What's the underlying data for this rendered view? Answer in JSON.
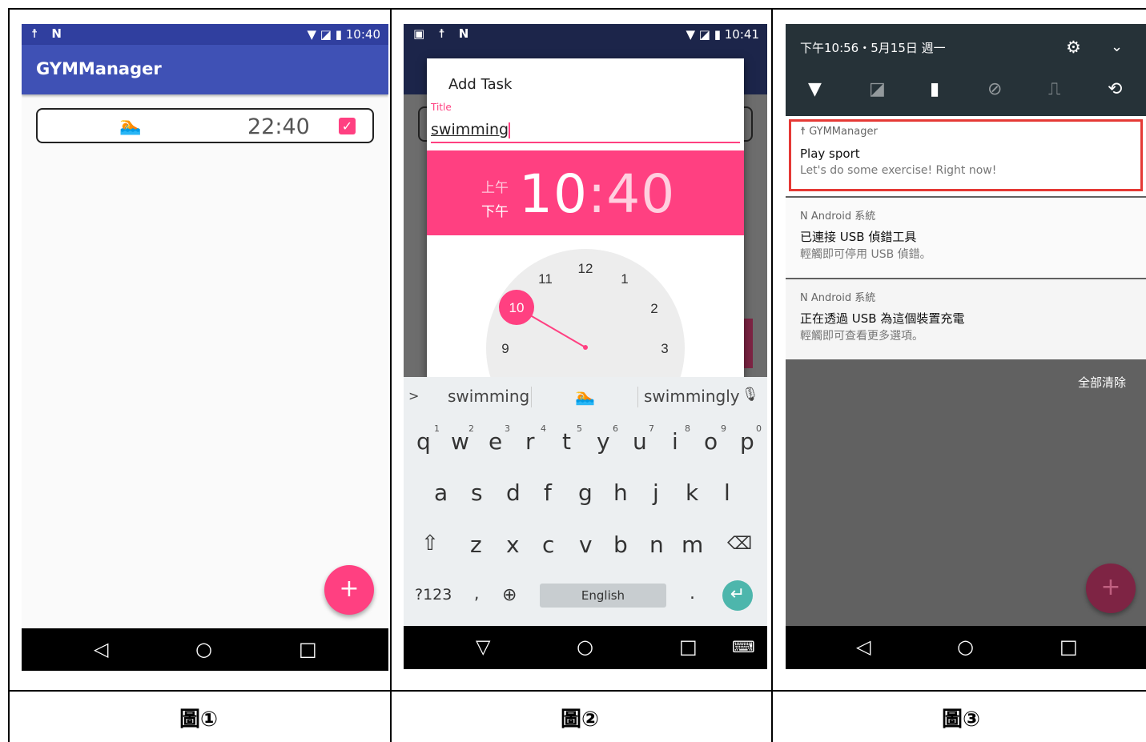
{
  "captions": [
    "圖①",
    "圖②",
    "圖③"
  ],
  "screen1": {
    "status": {
      "left_icons": "☨ N",
      "time": "10:40",
      "right_icons": "▼ ◪ ▮"
    },
    "app_title": "GYMManager",
    "task": {
      "emoji": "🏊",
      "time": "22:40",
      "checked": "✓"
    },
    "fab": "+",
    "nav": [
      "◁",
      "○",
      "□"
    ]
  },
  "screen2": {
    "status": {
      "left_icons": "▣ ☨ N",
      "time": "10:41",
      "right_icons": "▼ ◪ ▮"
    },
    "dialog": {
      "title": "Add Task",
      "field_label": "Title",
      "field_value": "swimming",
      "am": "上午",
      "pm": "下午",
      "hour": "10",
      "colon": ":",
      "minute": "40"
    },
    "clock": {
      "numbers": [
        "12",
        "1",
        "2",
        "3",
        "9",
        "11"
      ],
      "selected": "10"
    },
    "keyboard": {
      "suggestions": [
        "swimming",
        "🏊",
        "swimmingly"
      ],
      "row1": [
        "q",
        "w",
        "e",
        "r",
        "t",
        "y",
        "u",
        "i",
        "o",
        "p"
      ],
      "row1_nums": [
        "1",
        "2",
        "3",
        "4",
        "5",
        "6",
        "7",
        "8",
        "9",
        "0"
      ],
      "row2": [
        "a",
        "s",
        "d",
        "f",
        "g",
        "h",
        "j",
        "k",
        "l"
      ],
      "row3": [
        "z",
        "x",
        "c",
        "v",
        "b",
        "n",
        "m"
      ],
      "symbols_key": "?123",
      "comma_key": ",",
      "globe_key": "⊕",
      "space_label": "English",
      "period_key": ".",
      "enter_key": "↵",
      "shift_key": "⇧",
      "backspace_key": "⌫",
      "mic_key": "🎙",
      "chevron_key": ">"
    },
    "nav": [
      "▽",
      "○",
      "□",
      "⌨"
    ]
  },
  "screen3": {
    "date": "下午10:56・5月15日 週一",
    "gear": "⚙",
    "chevron": "⌄",
    "tiles": [
      "▼",
      "◪",
      "▮",
      "⊘",
      "⎍",
      "⟲"
    ],
    "notifications": [
      {
        "app": "GYMManager",
        "title": "Play sport",
        "text": "Let's do some exercise! Right now!"
      },
      {
        "app": "Android 系統",
        "title": "已連接 USB 偵錯工具",
        "text": "輕觸即可停用 USB 偵錯。"
      },
      {
        "app": "Android 系統",
        "title": "正在透過 USB 為這個裝置充電",
        "text": "輕觸即可查看更多選項。"
      }
    ],
    "clear_all": "全部清除",
    "fab": "+",
    "nav": [
      "◁",
      "○",
      "□"
    ]
  }
}
